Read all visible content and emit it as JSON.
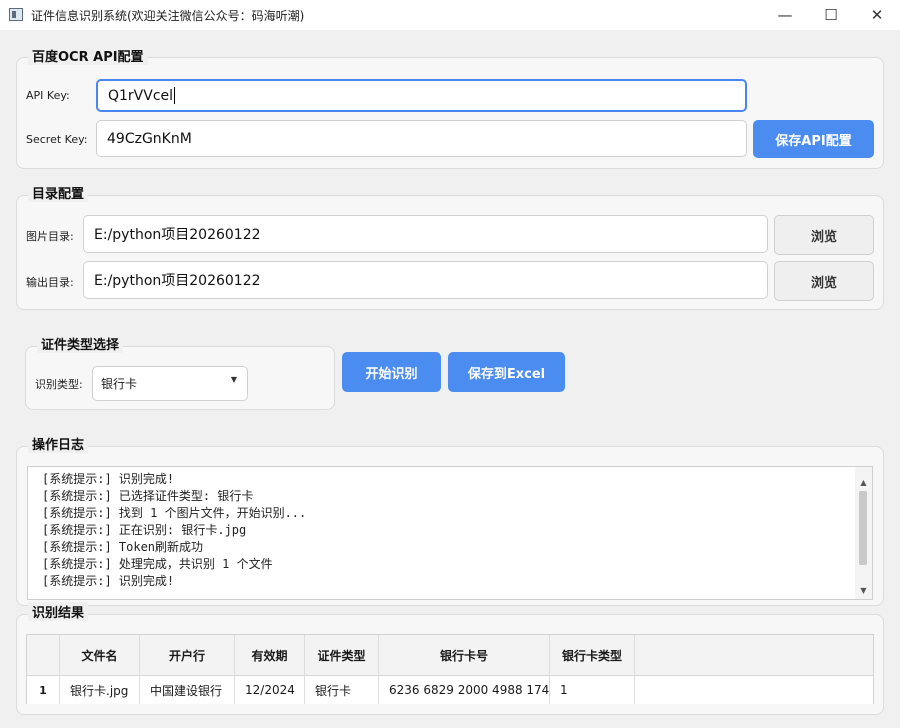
{
  "window": {
    "title": "证件信息识别系统(欢迎关注微信公众号：码海听潮)",
    "minimize_glyph": "—",
    "maximize_glyph": "☐",
    "close_glyph": "✕"
  },
  "api_config": {
    "title": "百度OCR API配置",
    "api_key_label": "API Key:",
    "api_key_value": "Q1rVVcel",
    "secret_key_label": "Secret Key:",
    "secret_key_value": "49CzGnKnM",
    "save_button": "保存API配置"
  },
  "dir_config": {
    "title": "目录配置",
    "image_dir_label": "图片目录:",
    "image_dir_value": "E:/python项目20260122",
    "output_dir_label": "输出目录:",
    "output_dir_value": "E:/python项目20260122",
    "browse_label": "浏览"
  },
  "type_select": {
    "title": "证件类型选择",
    "label": "识别类型:",
    "selected": "银行卡"
  },
  "actions": {
    "start": "开始识别",
    "save_excel": "保存到Excel"
  },
  "log": {
    "title": "操作日志",
    "lines": [
      "[系统提示:] 识别完成!",
      "[系统提示:] 已选择证件类型: 银行卡",
      "[系统提示:] 找到 1 个图片文件，开始识别...",
      "[系统提示:] 正在识别: 银行卡.jpg",
      "[系统提示:] Token刷新成功",
      "[系统提示:] 处理完成，共识别 1 个文件",
      "[系统提示:] 识别完成!"
    ]
  },
  "results": {
    "title": "识别结果",
    "columns": [
      "文件名",
      "开户行",
      "有效期",
      "证件类型",
      "银行卡号",
      "银行卡类型"
    ],
    "rows": [
      {
        "num": "1",
        "cells": [
          "银行卡.jpg",
          "中国建设银行",
          "12/2024",
          "银行卡",
          "6236 6829 2000 4988 174",
          "1"
        ]
      }
    ]
  }
}
